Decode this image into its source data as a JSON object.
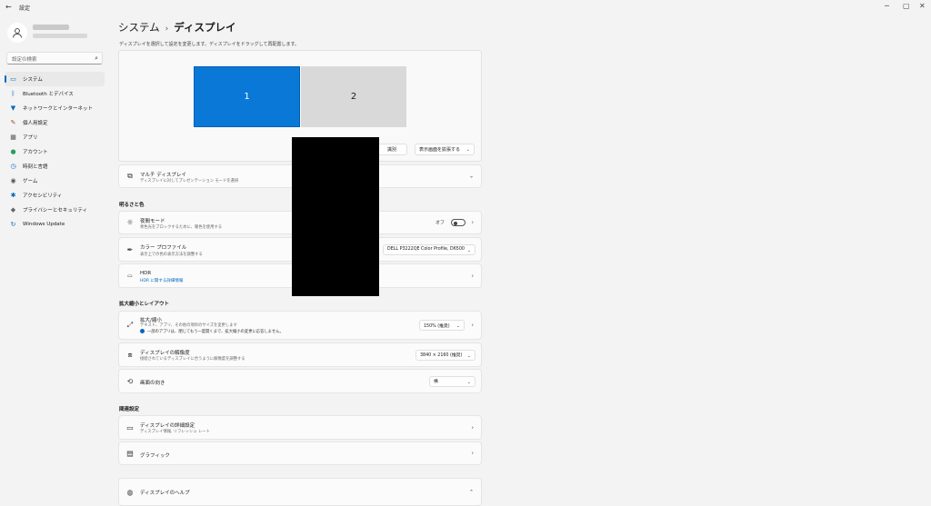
{
  "window": {
    "back_glyph": "←",
    "title": "設定",
    "controls": [
      "─",
      "▢",
      "✕"
    ]
  },
  "sidebar": {
    "search_placeholder": "設定の検索",
    "items": [
      {
        "label": "システム",
        "icon": "system-icon",
        "selected": true
      },
      {
        "label": "Bluetooth とデバイス",
        "icon": "bluetooth-icon"
      },
      {
        "label": "ネットワークとインターネット",
        "icon": "wifi-icon"
      },
      {
        "label": "個人用設定",
        "icon": "brush-icon"
      },
      {
        "label": "アプリ",
        "icon": "apps-icon"
      },
      {
        "label": "アカウント",
        "icon": "account-icon"
      },
      {
        "label": "時刻と言語",
        "icon": "clock-language-icon"
      },
      {
        "label": "ゲーム",
        "icon": "game-icon"
      },
      {
        "label": "アクセシビリティ",
        "icon": "accessibility-icon"
      },
      {
        "label": "プライバシーとセキュリティ",
        "icon": "shield-icon"
      },
      {
        "label": "Windows Update",
        "icon": "update-icon"
      }
    ]
  },
  "main": {
    "breadcrumb": {
      "parent": "システム",
      "separator": "›",
      "current": "ディスプレイ"
    },
    "arrange_hint": "ディスプレイを選択して設定を変更します。ディスプレイをドラッグして再配置します。",
    "monitors": [
      "1",
      "2"
    ],
    "identify_label": "識別",
    "extend_dropdown": "表示画面を拡張する",
    "multi_display": {
      "title": "マルチ ディスプレイ",
      "desc": "ディスプレイに対してプレゼンテーション モードを選択"
    },
    "brightness_section": "明るさと色",
    "night_light": {
      "title": "夜間モード",
      "desc": "青色光をブロックするために、暖色を使用する",
      "toggle_label": "オフ"
    },
    "color_profile": {
      "title": "カラー プロファイル",
      "desc": "表示上での色の表示方法を調整する",
      "value": "DELL P3222QE Color Profile, D6500"
    },
    "hdr": {
      "title": "HDR",
      "link": "HDR に関する詳細情報"
    },
    "scale_section": "拡大縮小とレイアウト",
    "scale": {
      "title": "拡大/縮小",
      "desc": "テキスト、アプリ、その他の項目のサイズを変更します",
      "note": "一部のアプリは、閉じてもう一度開くまで、拡大縮小の変更に応答しません。",
      "value": "150% (推奨)"
    },
    "resolution": {
      "title": "ディスプレイの解像度",
      "desc": "接続されているディスプレイに合うように解像度を調整する",
      "value": "3840 × 2160 (推奨)"
    },
    "orientation": {
      "title": "画面の向き",
      "value": "横"
    },
    "related_section": "関連設定",
    "advanced_display": {
      "title": "ディスプレイの詳細設定",
      "desc": "ディスプレイ情報, リフレッシュ レート"
    },
    "graphics": {
      "title": "グラフィック"
    },
    "help": {
      "title": "ディスプレイのヘルプ"
    }
  }
}
